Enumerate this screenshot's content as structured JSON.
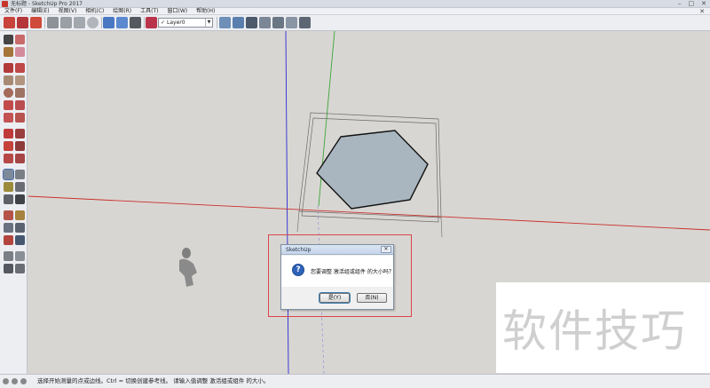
{
  "window": {
    "title": "无标题 - SketchUp Pro 2017",
    "minimize": "–",
    "maximize": "□",
    "close": "✕"
  },
  "menu": {
    "items": [
      {
        "label": "文件(F)"
      },
      {
        "label": "编辑(E)"
      },
      {
        "label": "视图(V)"
      },
      {
        "label": "相机(C)"
      },
      {
        "label": "绘图(R)"
      },
      {
        "label": "工具(T)"
      },
      {
        "label": "窗口(W)"
      },
      {
        "label": "帮助(H)"
      }
    ],
    "close_doc": "✕"
  },
  "toolbar": {
    "layer": {
      "check": "✓",
      "value": "Layer0",
      "arrow": "▼"
    }
  },
  "dialog": {
    "title": "SketchUp",
    "close": "✕",
    "icon": "question-icon",
    "icon_glyph": "?",
    "message": "您要调整 激活组或组件 的大小吗？",
    "yes": "是(Y)",
    "no": "否(N)"
  },
  "watermark": {
    "text": "软件技巧"
  },
  "status": {
    "text": "选择开始测量的点或边线。Ctrl = 切换创建参考线。 请输入值调整 激活组或组件 的大小。"
  },
  "colors": {
    "accent_red": "#d9454a",
    "axis_red": "#c9302c",
    "axis_green": "#3aa53a",
    "axis_blue": "#2a2ad6",
    "hexagon_fill": "#a9b6c0"
  }
}
